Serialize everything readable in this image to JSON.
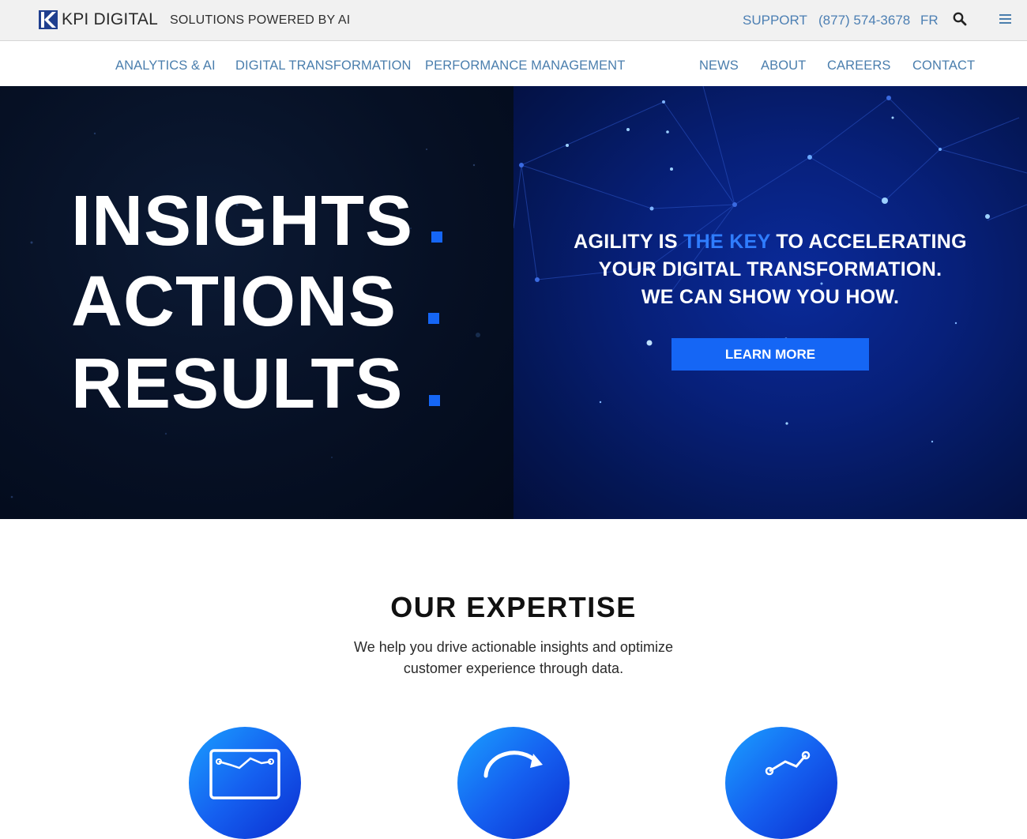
{
  "topbar": {
    "logo_text": "KPI DIGITAL",
    "tagline": "SOLUTIONS POWERED BY AI",
    "support_label": "SUPPORT",
    "phone": "(877) 574-3678",
    "lang_label": "FR",
    "search_icon": "search-icon",
    "menu_icon": "hamburger-menu-icon"
  },
  "nav": {
    "left": [
      "ANALYTICS & AI",
      "DIGITAL TRANSFORMATION",
      "PERFORMANCE MANAGEMENT"
    ],
    "right": [
      "NEWS",
      "ABOUT",
      "CAREERS",
      "CONTACT"
    ]
  },
  "hero": {
    "words": [
      "INSIGHTS",
      "ACTIONS",
      "RESULTS"
    ],
    "headline_part1": "AGILITY IS ",
    "headline_accent": "THE KEY",
    "headline_part2": " TO ACCELERATING",
    "headline_line2": "YOUR DIGITAL TRANSFORMATION.",
    "headline_line3": "WE CAN SHOW YOU HOW.",
    "cta_label": "LEARN MORE",
    "accent_color": "#1566f5"
  },
  "expertise": {
    "title": "OUR EXPERTISE",
    "subtitle_line1": "We help you drive actionable insights and optimize",
    "subtitle_line2": "customer experience through data.",
    "icons": [
      "analytics-icon",
      "refresh-cycle-icon",
      "growth-chart-icon"
    ]
  },
  "colors": {
    "link_blue": "#4a7ead",
    "topbar_bg": "#f1f1f1",
    "hero_left_bg": "#061024",
    "hero_right_bg": "#07207a"
  }
}
